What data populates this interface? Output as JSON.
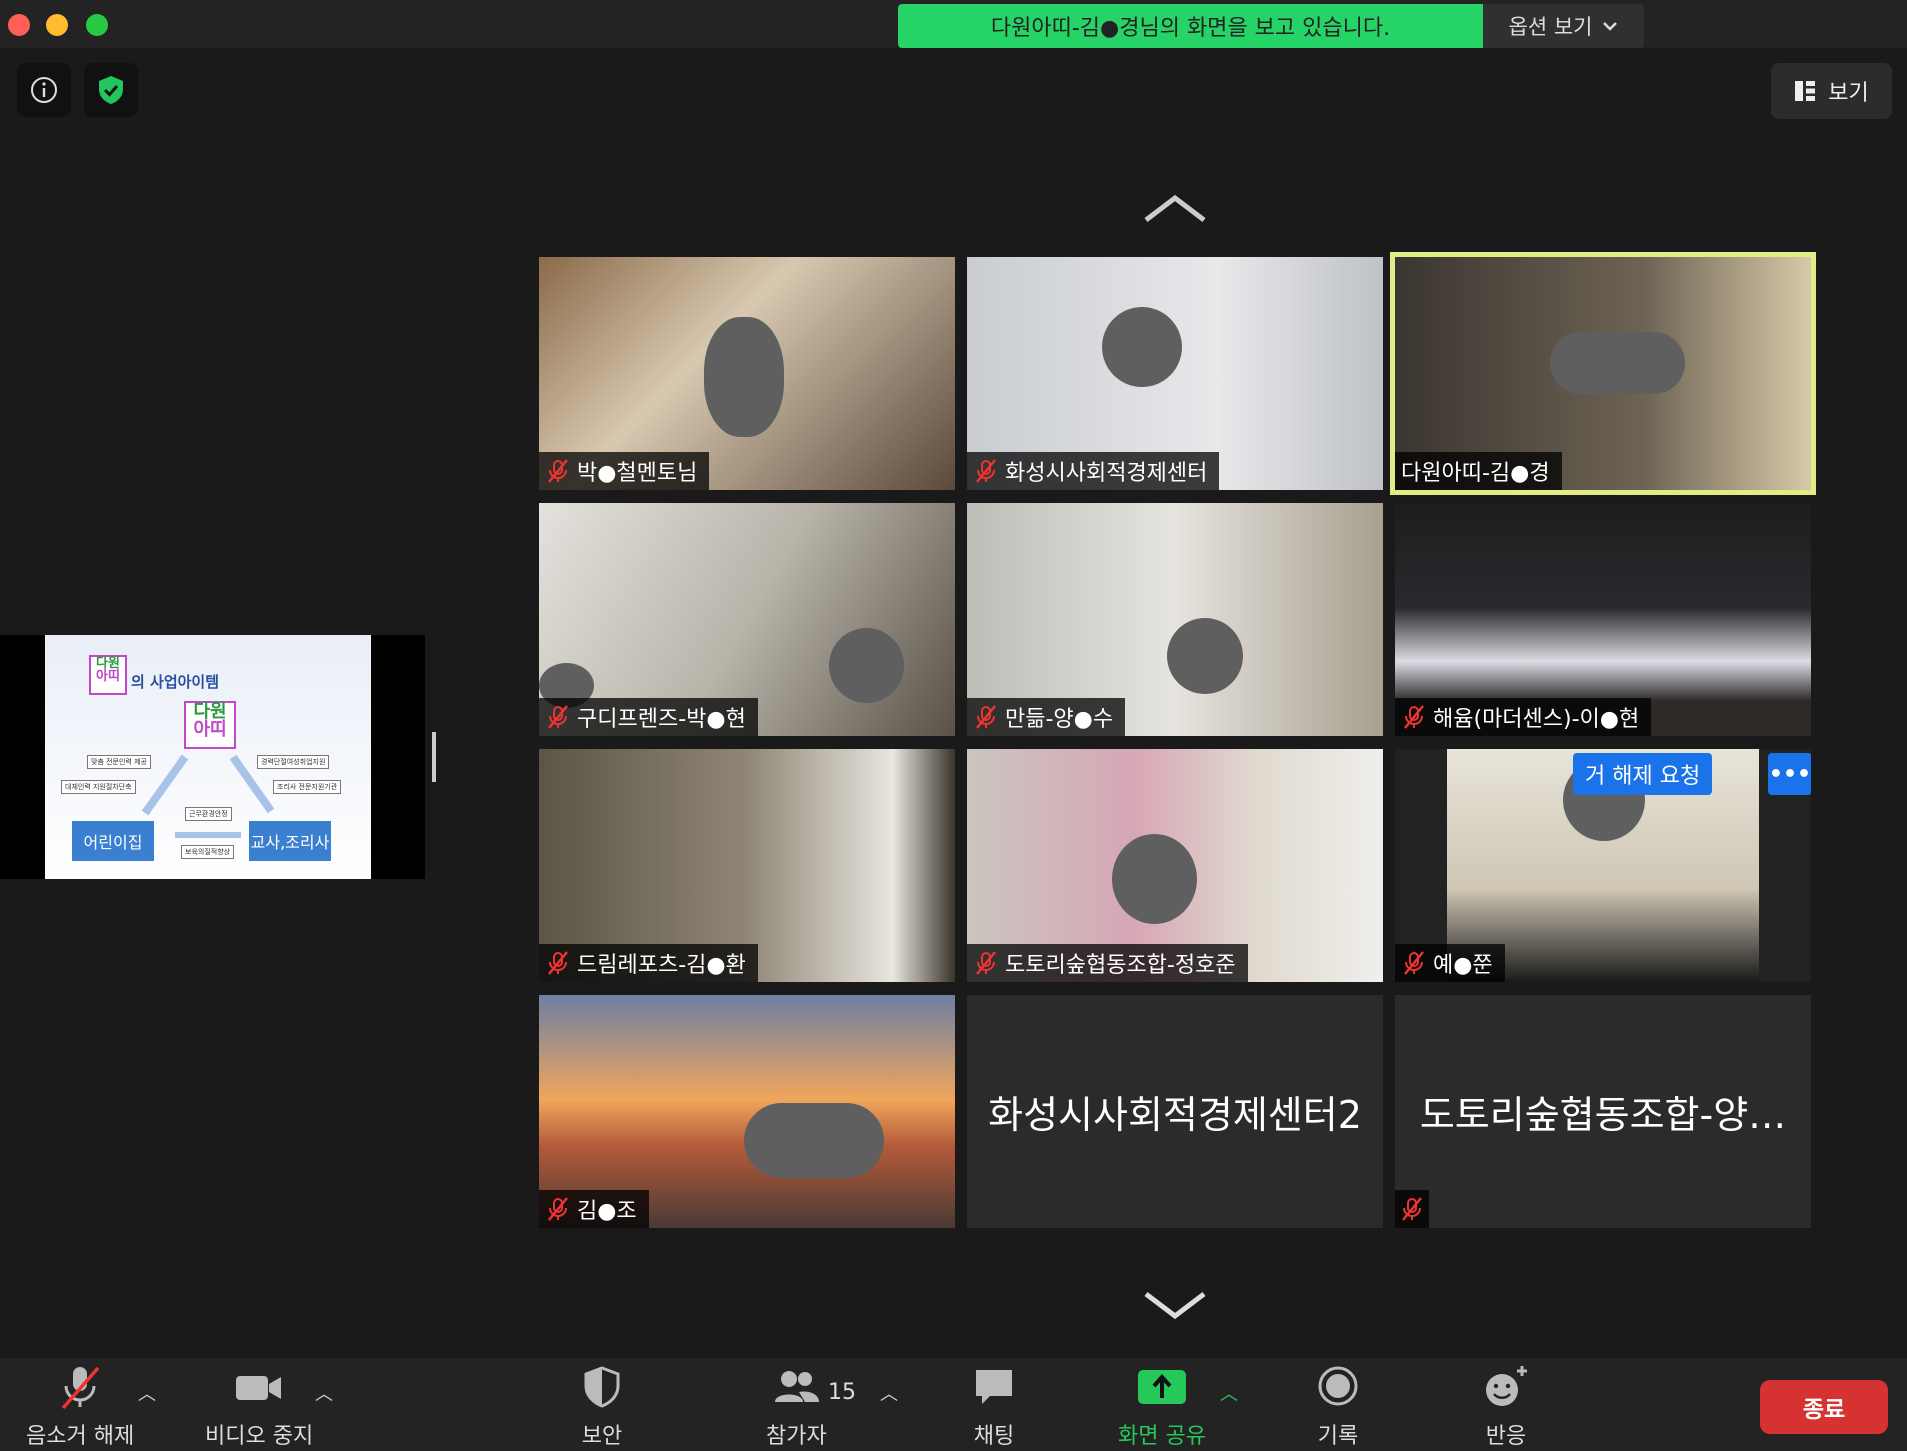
{
  "share_banner": {
    "text": "다원아띠-김●경님의 화면을 보고 있습니다.",
    "options_label": "옵션 보기"
  },
  "top_bar": {
    "view_label": "보기"
  },
  "shared_slide": {
    "logo_top": "다원",
    "logo_bottom": "아띠",
    "title": "의 사업아이템",
    "center_logo_top": "다원",
    "center_logo_bottom": "아띠",
    "boxes": [
      "맞춤 전문인력 제공",
      "대체인력 지원절차단축",
      "경력단절여성취업지원",
      "조리사 전문지원기관",
      "근무환경안정",
      "보육의질적향상"
    ],
    "left_button": "어린이집",
    "right_button": "교사,조리사"
  },
  "participants": [
    {
      "name": "박●철멘토님",
      "muted": true,
      "active": false
    },
    {
      "name": "화성시사회적경제센터",
      "muted": true,
      "active": false
    },
    {
      "name": "다원아띠-김●경",
      "muted": false,
      "active": true
    },
    {
      "name": "구디프렌즈-박●현",
      "muted": true,
      "active": false
    },
    {
      "name": "만듦-양●수",
      "muted": true,
      "active": false
    },
    {
      "name": "해윰(마더센스)-이●현",
      "muted": true,
      "active": false
    },
    {
      "name": "드림레포츠-김●환",
      "muted": true,
      "active": false
    },
    {
      "name": "도토리숲협동조합-정호준",
      "muted": true,
      "active": false
    },
    {
      "name": "예●쭌",
      "muted": true,
      "active": false
    },
    {
      "name": "김●조",
      "muted": true,
      "active": false
    },
    {
      "name": "화성시사회적경제센터2",
      "muted": false,
      "active": false
    },
    {
      "name": "도토리숲협동조합-양…",
      "muted": true,
      "active": false
    }
  ],
  "unmute_request": {
    "label": "거 해제 요청",
    "more": "•••"
  },
  "toolbar": {
    "unmute": "음소거 해제",
    "stop_video": "비디오 중지",
    "security": "보안",
    "participants": "참가자",
    "participants_count": "15",
    "chat": "채팅",
    "share_screen": "화면 공유",
    "record": "기록",
    "reactions": "반응",
    "end": "종료"
  },
  "colors": {
    "banner_green": "#26d366",
    "active_outline": "#e2ec86",
    "end_red": "#d73232",
    "share_green": "#26c85a",
    "request_blue": "#1a73e8"
  }
}
